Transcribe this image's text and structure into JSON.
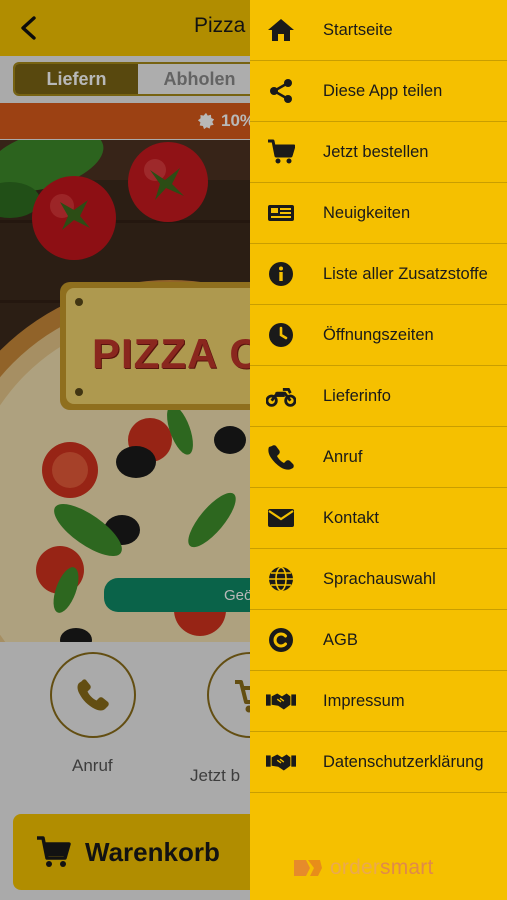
{
  "header": {
    "title": "Pizza C"
  },
  "order_mode": {
    "tabs": [
      {
        "label": "Liefern"
      },
      {
        "label": "Abholen"
      }
    ]
  },
  "promo": {
    "text": "10%"
  },
  "hero": {
    "sign_text": "PIZZA C",
    "button_label": "Geö"
  },
  "actions": [
    {
      "label": "Anruf"
    },
    {
      "label": "Jetzt b"
    }
  ],
  "cart": {
    "label": "Warenkorb"
  },
  "drawer": {
    "items": [
      {
        "label": "Startseite",
        "icon": "home-icon"
      },
      {
        "label": "Diese App teilen",
        "icon": "share-icon"
      },
      {
        "label": "Jetzt bestellen",
        "icon": "cart-icon"
      },
      {
        "label": "Neuigkeiten",
        "icon": "news-icon"
      },
      {
        "label": "Liste aller Zusatzstoffe",
        "icon": "info-icon"
      },
      {
        "label": "Öffnungszeiten",
        "icon": "clock-icon"
      },
      {
        "label": "Lieferinfo",
        "icon": "motorcycle-icon"
      },
      {
        "label": "Anruf",
        "icon": "phone-icon"
      },
      {
        "label": "Kontakt",
        "icon": "envelope-icon"
      },
      {
        "label": "Sprachauswahl",
        "icon": "globe-icon"
      },
      {
        "label": "AGB",
        "icon": "copyright-icon"
      },
      {
        "label": "Impressum",
        "icon": "handshake-icon"
      },
      {
        "label": "Datenschutzerklärung",
        "icon": "handshake-icon"
      }
    ],
    "brand": {
      "part1": "order",
      "part2": "smart"
    }
  },
  "colors": {
    "accent": "#f5c000",
    "promo": "#d95a1b",
    "button_green": "#0f8a66"
  }
}
